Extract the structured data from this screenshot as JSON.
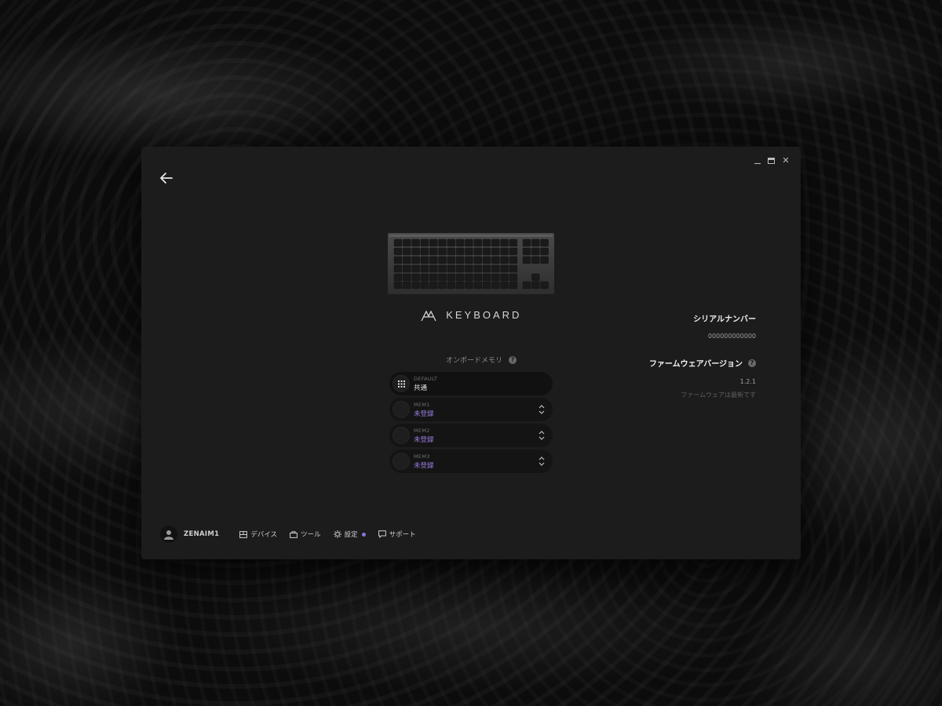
{
  "window": {
    "controls": {
      "minimize": "",
      "maximize": "",
      "close": "✕"
    }
  },
  "device": {
    "brand_text": "KEYBOARD"
  },
  "memory": {
    "title": "オンボードメモリ",
    "help_glyph": "?",
    "slots": [
      {
        "tag": "DEFAULT",
        "name": "共通",
        "icon": "grid-icon",
        "has_chevron": false
      },
      {
        "tag": "MEM1",
        "name": "未登録",
        "icon": "empty-circle",
        "has_chevron": true
      },
      {
        "tag": "MEM2",
        "name": "未登録",
        "icon": "empty-circle",
        "has_chevron": true
      },
      {
        "tag": "MEM3",
        "name": "未登録",
        "icon": "empty-circle",
        "has_chevron": true
      }
    ]
  },
  "info": {
    "serial_label": "シリアルナンバー",
    "serial_value": "000000000000",
    "firmware_label": "ファームウェアバージョン",
    "firmware_help": "?",
    "firmware_value": "1.2.1",
    "firmware_status": "ファームウェアは最新です"
  },
  "footer": {
    "username": "ZENAIM1",
    "nav": [
      {
        "label": "デバイス",
        "icon": "device-icon"
      },
      {
        "label": "ツール",
        "icon": "toolbox-icon"
      },
      {
        "label": "設定",
        "icon": "gear-icon",
        "notification": true
      },
      {
        "label": "サポート",
        "icon": "chat-icon"
      }
    ]
  },
  "colors": {
    "accent": "#9b7fe0",
    "window_bg": "#1c1c1d",
    "slot_bg": "#141414"
  }
}
